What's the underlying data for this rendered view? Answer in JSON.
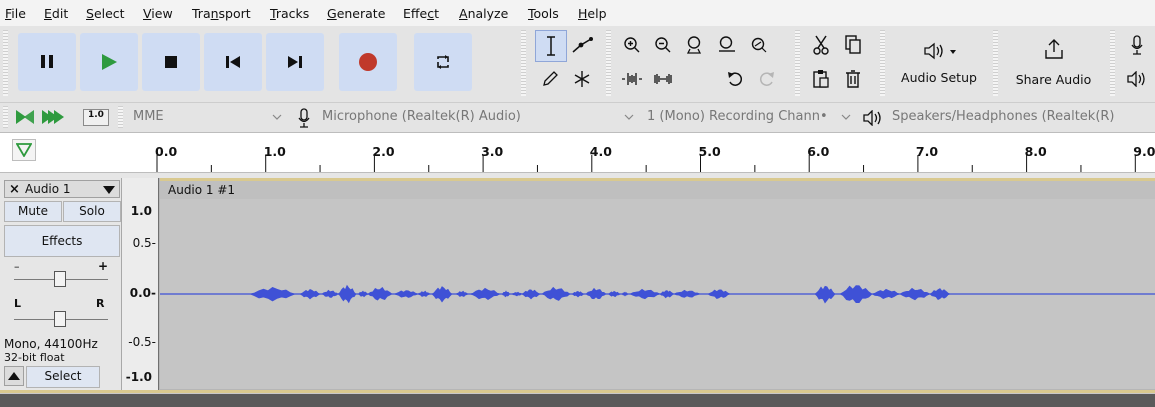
{
  "menu": [
    {
      "pre": "",
      "u": "F",
      "post": "ile"
    },
    {
      "pre": "",
      "u": "E",
      "post": "dit"
    },
    {
      "pre": "",
      "u": "S",
      "post": "elect"
    },
    {
      "pre": "",
      "u": "V",
      "post": "iew"
    },
    {
      "pre": "Tra",
      "u": "n",
      "post": "sport"
    },
    {
      "pre": "",
      "u": "T",
      "post": "racks"
    },
    {
      "pre": "",
      "u": "G",
      "post": "enerate"
    },
    {
      "pre": "Effe",
      "u": "c",
      "post": "t"
    },
    {
      "pre": "",
      "u": "A",
      "post": "nalyze"
    },
    {
      "pre": "",
      "u": "T",
      "post": "ools"
    },
    {
      "pre": "",
      "u": "H",
      "post": "elp"
    }
  ],
  "toolbar": {
    "audio_setup_label": "Audio Setup",
    "share_audio_label": "Share Audio"
  },
  "device": {
    "host": "MME",
    "mic": "Microphone (Realtek(R) Audio)",
    "channels": "1 (Mono) Recording Chann•",
    "speakers": "Speakers/Headphones (Realtek(R)",
    "meter_value": "1.0"
  },
  "ruler": {
    "ticks": [
      "0.0",
      "1.0",
      "2.0",
      "3.0",
      "4.0",
      "5.0",
      "6.0",
      "7.0",
      "8.0",
      "9.0"
    ]
  },
  "track": {
    "name": "Audio 1",
    "mute": "Mute",
    "solo": "Solo",
    "effects": "Effects",
    "gain_minus": "–",
    "gain_plus": "+",
    "pan_left": "L",
    "pan_right": "R",
    "format": "Mono, 44100Hz",
    "bitdepth": "32-bit float",
    "select": "Select",
    "clip_name": "Audio 1 #1",
    "scale": [
      "1.0",
      "0.5-",
      "0.0-",
      "-0.5-",
      "-1.0"
    ]
  },
  "colors": {
    "waveform": "#3f51d6",
    "play_green": "#2e9a3e",
    "record_red": "#c0392b"
  }
}
